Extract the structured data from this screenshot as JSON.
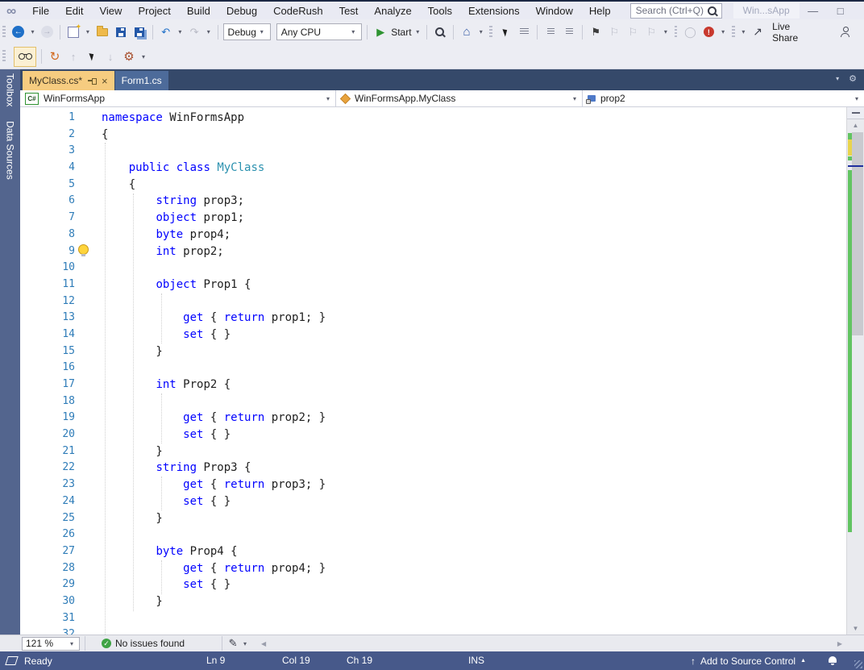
{
  "window": {
    "title_truncated": "Win...sApp"
  },
  "titlebar": {
    "menu_items": [
      "File",
      "Edit",
      "View",
      "Project",
      "Build",
      "Debug",
      "CodeRush",
      "Test",
      "Analyze",
      "Tools",
      "Extensions",
      "Window",
      "Help"
    ],
    "search_placeholder": "Search (Ctrl+Q)"
  },
  "toolbar": {
    "debug_target": "Debug",
    "platform": "Any CPU",
    "start": "Start",
    "live_share": "Live Share"
  },
  "tabs": [
    {
      "label": "MyClass.cs*",
      "active": true
    },
    {
      "label": "Form1.cs",
      "active": false
    }
  ],
  "side_panel_tabs": [
    "Toolbox",
    "Data Sources"
  ],
  "navbar": {
    "project": "WinFormsApp",
    "type": "WinFormsApp.MyClass",
    "member": "prop2"
  },
  "editor": {
    "zoom_level": "121 %",
    "health_status": "No issues found",
    "lightbulb_line": 9,
    "colors": {
      "keyword": "#0000FF",
      "type": "#2B91AF",
      "text": "#1E1E1E",
      "line_number": "#2E7CB8",
      "change_saved": "#62C462",
      "change_unsaved": "#E8D44D",
      "caret_marker": "#1F2F9E"
    },
    "lines": [
      [
        [
          "k",
          "namespace"
        ],
        [
          "p",
          " WinFormsApp"
        ]
      ],
      [
        [
          "p",
          "{"
        ]
      ],
      [],
      [
        [
          "p",
          "    "
        ],
        [
          "k",
          "public"
        ],
        [
          "p",
          " "
        ],
        [
          "k",
          "class"
        ],
        [
          "p",
          " "
        ],
        [
          "t",
          "MyClass"
        ]
      ],
      [
        [
          "p",
          "    {"
        ]
      ],
      [
        [
          "p",
          "        "
        ],
        [
          "k",
          "string"
        ],
        [
          "p",
          " prop3;"
        ]
      ],
      [
        [
          "p",
          "        "
        ],
        [
          "k",
          "object"
        ],
        [
          "p",
          " prop1;"
        ]
      ],
      [
        [
          "p",
          "        "
        ],
        [
          "k",
          "byte"
        ],
        [
          "p",
          " prop4;"
        ]
      ],
      [
        [
          "p",
          "        "
        ],
        [
          "k",
          "int"
        ],
        [
          "p",
          " prop2;"
        ]
      ],
      [],
      [
        [
          "p",
          "        "
        ],
        [
          "k",
          "object"
        ],
        [
          "p",
          " Prop1 {"
        ]
      ],
      [],
      [
        [
          "p",
          "            "
        ],
        [
          "k",
          "get"
        ],
        [
          "p",
          " { "
        ],
        [
          "k",
          "return"
        ],
        [
          "p",
          " prop1; }"
        ]
      ],
      [
        [
          "p",
          "            "
        ],
        [
          "k",
          "set"
        ],
        [
          "p",
          " { }"
        ]
      ],
      [
        [
          "p",
          "        }"
        ]
      ],
      [],
      [
        [
          "p",
          "        "
        ],
        [
          "k",
          "int"
        ],
        [
          "p",
          " Prop2 {"
        ]
      ],
      [],
      [
        [
          "p",
          "            "
        ],
        [
          "k",
          "get"
        ],
        [
          "p",
          " { "
        ],
        [
          "k",
          "return"
        ],
        [
          "p",
          " prop2; }"
        ]
      ],
      [
        [
          "p",
          "            "
        ],
        [
          "k",
          "set"
        ],
        [
          "p",
          " { }"
        ]
      ],
      [
        [
          "p",
          "        }"
        ]
      ],
      [
        [
          "p",
          "        "
        ],
        [
          "k",
          "string"
        ],
        [
          "p",
          " Prop3 {"
        ]
      ],
      [
        [
          "p",
          "            "
        ],
        [
          "k",
          "get"
        ],
        [
          "p",
          " { "
        ],
        [
          "k",
          "return"
        ],
        [
          "p",
          " prop3; }"
        ]
      ],
      [
        [
          "p",
          "            "
        ],
        [
          "k",
          "set"
        ],
        [
          "p",
          " { }"
        ]
      ],
      [
        [
          "p",
          "        }"
        ]
      ],
      [],
      [
        [
          "p",
          "        "
        ],
        [
          "k",
          "byte"
        ],
        [
          "p",
          " Prop4 {"
        ]
      ],
      [
        [
          "p",
          "            "
        ],
        [
          "k",
          "get"
        ],
        [
          "p",
          " { "
        ],
        [
          "k",
          "return"
        ],
        [
          "p",
          " prop4; }"
        ]
      ],
      [
        [
          "p",
          "            "
        ],
        [
          "k",
          "set"
        ],
        [
          "p",
          " { }"
        ]
      ],
      [
        [
          "p",
          "        }"
        ]
      ],
      [],
      []
    ]
  },
  "statusbar": {
    "state": "Ready",
    "line": "Ln 9",
    "column": "Col 19",
    "character": "Ch 19",
    "mode": "INS",
    "source_control": "Add to Source Control"
  },
  "icons": {
    "csharp": "C#",
    "back": "←",
    "forward": "→",
    "undo": "↶",
    "redo": "↷",
    "start_play": "▶",
    "dropdown": "▾",
    "home": "⌂",
    "bookmark": "⚑",
    "bookmark_ghost": "⚐",
    "breakpoint": "◯",
    "gear": "⚙",
    "jump": "↻",
    "arrow_up": "↑",
    "arrow_down": "↓",
    "live_share": "↗",
    "scroll_up": "▲",
    "scroll_down": "▼",
    "scroll_left": "◀",
    "scroll_right": "▶",
    "check": "✓",
    "brush": "✎",
    "minimize": "—",
    "maximize": "□",
    "close": "×",
    "error_mark": "!",
    "vs_logo": "∞",
    "caret_up": "▲"
  }
}
